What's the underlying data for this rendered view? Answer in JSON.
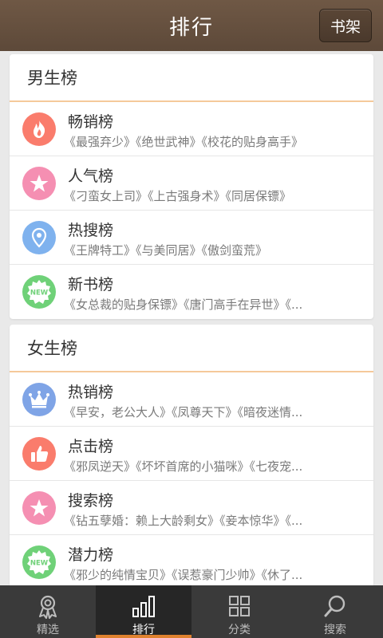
{
  "header": {
    "title": "排行",
    "bookshelf_label": "书架"
  },
  "sections": [
    {
      "title": "男生榜",
      "items": [
        {
          "name": "畅销榜",
          "books": "《最强弃少》《绝世武神》《校花的贴身高手》",
          "icon": "flame-icon",
          "color": "#fa7c6c"
        },
        {
          "name": "人气榜",
          "books": "《刁蛮女上司》《上古强身术》《同居保镖》",
          "icon": "star-icon",
          "color": "#f58fb2"
        },
        {
          "name": "热搜榜",
          "books": "《王牌特工》《与美同居》《傲剑蛮荒》",
          "icon": "location-pin-icon",
          "color": "#7fb2ee"
        },
        {
          "name": "新书榜",
          "books": "《女总裁的贴身保镖》《唐门高手在异世》《...",
          "icon": "new-badge-icon",
          "color": "#6fd178"
        }
      ]
    },
    {
      "title": "女生榜",
      "items": [
        {
          "name": "热销榜",
          "books": "《早安，老公大人》《凤尊天下》《暗夜迷情...",
          "icon": "crown-icon",
          "color": "#7fa4e6"
        },
        {
          "name": "点击榜",
          "books": "《邪凤逆天》《坏坏首席的小猫咪》《七夜宠...",
          "icon": "thumbs-up-icon",
          "color": "#fa7c6c"
        },
        {
          "name": "搜索榜",
          "books": "《钻五孽婚：赖上大龄剩女》《妾本惊华》《...",
          "icon": "star-icon",
          "color": "#f58fb2"
        },
        {
          "name": "潜力榜",
          "books": "《邪少的纯情宝贝》《误惹豪门少帅》《休了...",
          "icon": "new-badge-icon",
          "color": "#6fd178"
        }
      ]
    }
  ],
  "icon_badge_text": "NEW",
  "tabs": [
    {
      "label": "精选",
      "icon": "award-ribbon-icon",
      "active": false
    },
    {
      "label": "排行",
      "icon": "bar-chart-icon",
      "active": true
    },
    {
      "label": "分类",
      "icon": "grid-icon",
      "active": false
    },
    {
      "label": "搜索",
      "icon": "search-icon",
      "active": false
    }
  ],
  "colors": {
    "header": "#5d4939",
    "accent": "#e0822f",
    "divider": "#f5c99a",
    "tabbar": "#3a3a3a"
  }
}
